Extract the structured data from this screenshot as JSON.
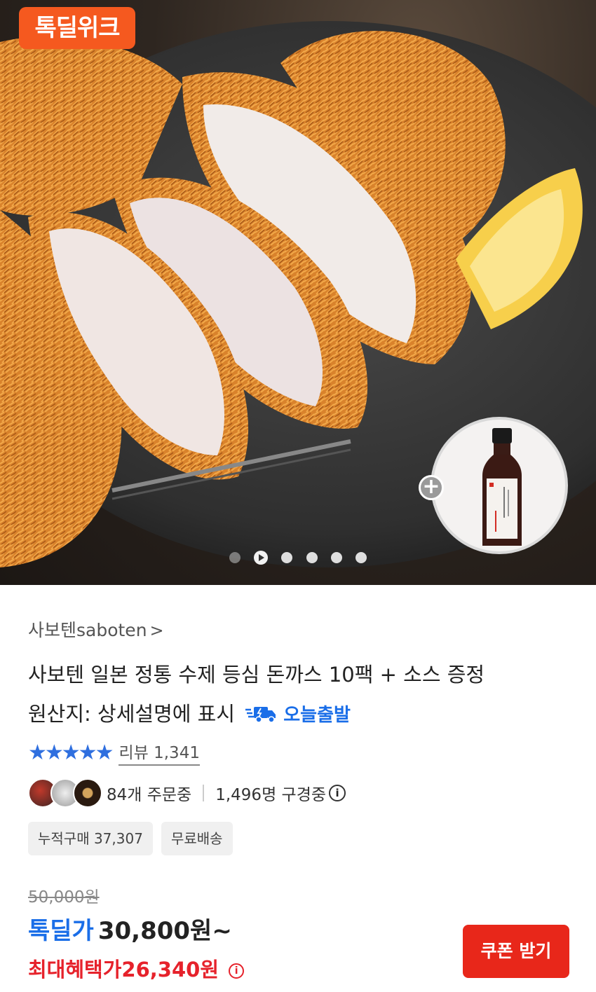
{
  "hero": {
    "badge": "톡딜위크",
    "gallery_dot_count": 6,
    "active_dot": 1
  },
  "product": {
    "brand": "사보텐saboten",
    "brand_chevron": ">",
    "title_line1": "사보텐 일본 정통 수제 등심 돈까스 10팩 + 소스 증정",
    "title_line2": "원산지: 상세설명에 표시",
    "shipping_badge": "오늘출발",
    "stars": "★★★★★",
    "review_label": "리뷰 1,341",
    "orders": "84개 주문중",
    "viewers": "1,496명 구경중",
    "tags": [
      "누적구매 37,307",
      "무료배송"
    ],
    "original_price": "50,000원",
    "deal_label": "톡딜가",
    "deal_price": "30,800원~",
    "max_label": "최대혜택가",
    "max_price": "26,340원",
    "coupon_button": "쿠폰 받기"
  },
  "colors": {
    "accent_blue": "#1a6ee8",
    "deal_red": "#e6222b",
    "badge_orange": "#f5591f",
    "button_red": "#e8271a"
  }
}
